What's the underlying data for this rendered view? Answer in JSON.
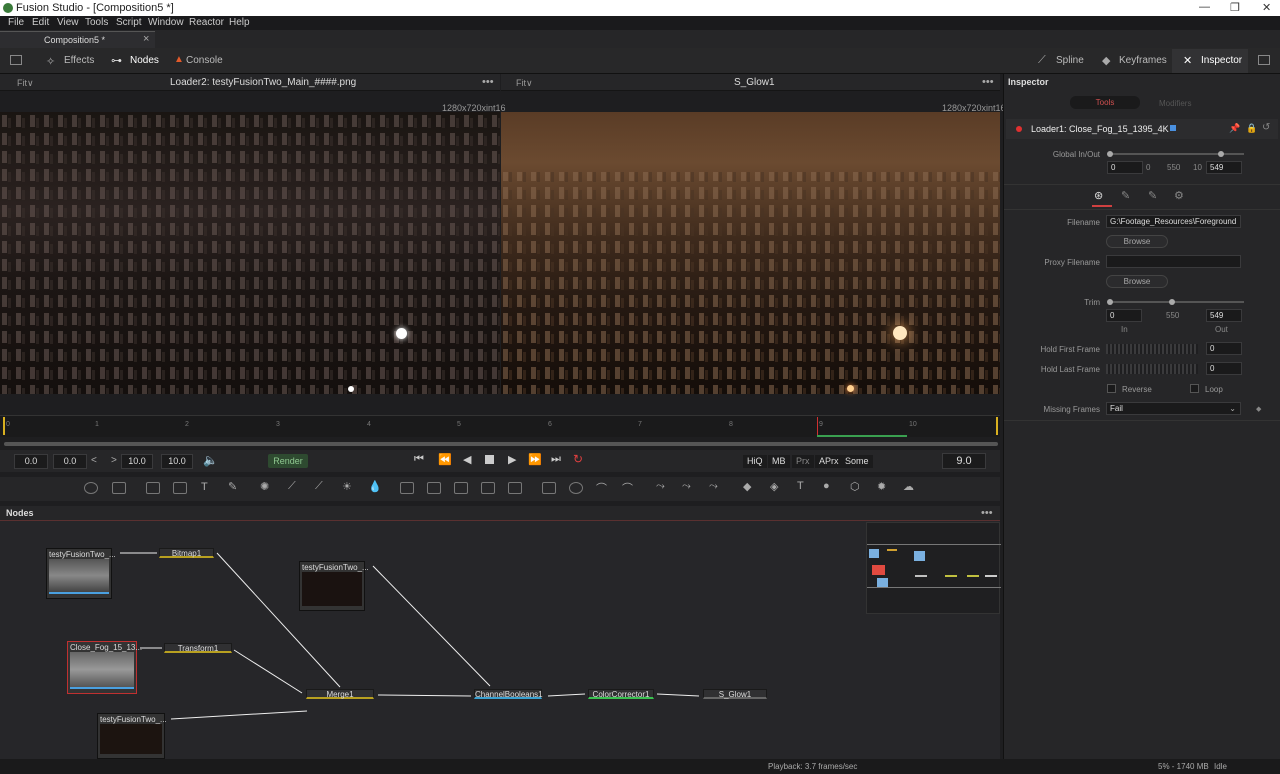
{
  "window": {
    "title": "Fusion Studio - [Composition5 *]",
    "min": "—",
    "max": "❐",
    "close": "✕"
  },
  "menu": [
    "File",
    "Edit",
    "View",
    "Tools",
    "Script",
    "Window",
    "Reactor",
    "Help"
  ],
  "tab": {
    "label": "Composition5 *",
    "close": "×"
  },
  "toolbar": {
    "effects": "Effects",
    "nodes": "Nodes",
    "console": "Console",
    "spline": "Spline",
    "keyframes": "Keyframes",
    "inspector": "Inspector"
  },
  "viewer1": {
    "fit": "Fit∨",
    "title": "Loader2: testyFusionTwo_Main_####.png",
    "res": "1280x720xint16"
  },
  "viewer2": {
    "fit": "Fit∨",
    "title": "S_Glow1",
    "res": "1280x720xint16"
  },
  "timeline": {
    "ticks": [
      "0",
      "1",
      "2",
      "3",
      "4",
      "5",
      "6",
      "7",
      "8",
      "9",
      "10"
    ]
  },
  "transport": {
    "start": "0.0",
    "render_start": "0.0",
    "render_end": "10.0",
    "end": "10.0",
    "render": "Render",
    "hiq": "HiQ",
    "mb": "MB",
    "prx": "Prx",
    "aprx": "APrx",
    "some": "Some",
    "frame": "9.0",
    "lt": "<",
    ">": ">"
  },
  "nodes": {
    "header": "Nodes",
    "items": {
      "loaderA": "testyFusionTwo_...",
      "bitmap": "Bitmap1",
      "loaderB": "testyFusionTwo_...",
      "fog": "Close_Fog_15_13...",
      "transform": "Transform1",
      "merge": "Merge1",
      "cb": "ChannelBooleans1",
      "cc": "ColorCorrector1",
      "glow": "S_Glow1",
      "loaderC": "testyFusionTwo_..."
    }
  },
  "status": {
    "playback": "Playback: 3.7 frames/sec",
    "mem": "5% - 1740 MB",
    "state": "Idle"
  },
  "inspector": {
    "title": "Inspector",
    "tab_tools": "Tools",
    "tab_modifiers": "Modifiers",
    "tool": "Loader1: Close_Fog_15_1395_4K",
    "global_label": "Global In/Out",
    "g_in": "0",
    "g_mid1": "0",
    "g_mid2": "550",
    "g_mid3": "10",
    "g_out": "549",
    "filename_label": "Filename",
    "filename": "G:\\Footage_Resources\\Foreground",
    "browse": "Browse",
    "proxy_label": "Proxy Filename",
    "trim_label": "Trim",
    "trim_in": "0",
    "trim_mid": "550",
    "trim_out": "549",
    "in_label": "In",
    "out_label": "Out",
    "hold_first": "Hold First Frame",
    "hold_first_v": "0",
    "hold_last": "Hold Last Frame",
    "hold_last_v": "0",
    "reverse": "Reverse",
    "loop": "Loop",
    "missing": "Missing Frames",
    "missing_v": "Fail"
  }
}
